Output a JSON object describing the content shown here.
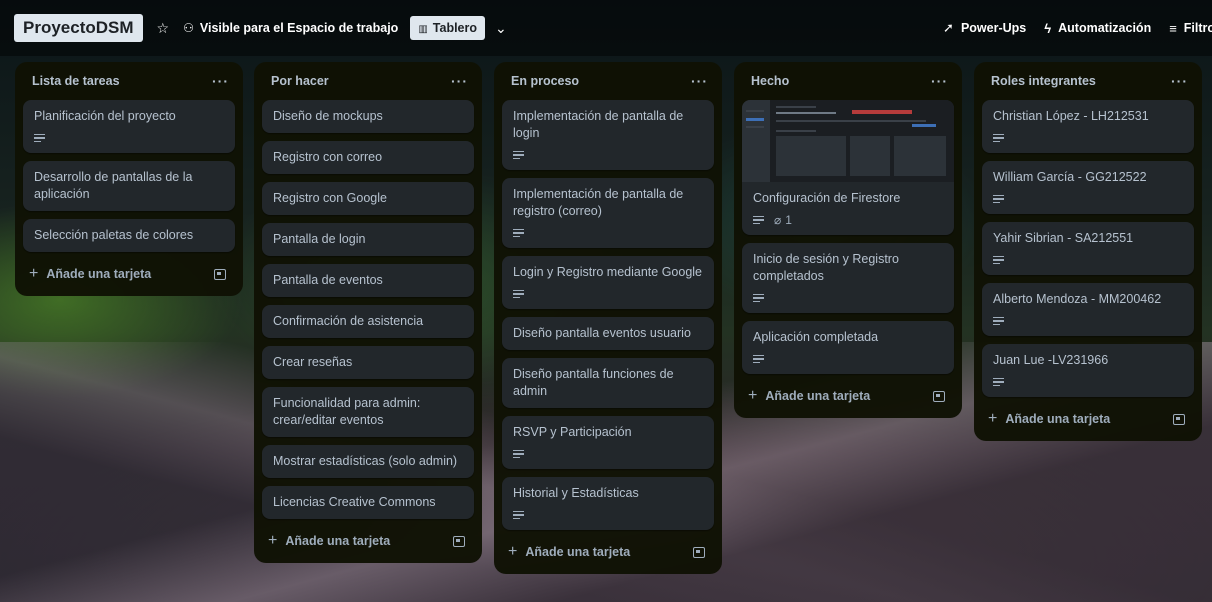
{
  "topbar": {
    "board_name": "ProyectoDSM",
    "visibility": "Visible para el Espacio de trabajo",
    "view_label": "Tablero",
    "power_ups": "Power-Ups",
    "automation": "Automatización",
    "filters": "Filtros"
  },
  "lists": [
    {
      "title": "Lista de tareas",
      "cards": [
        {
          "title": "Planificación del proyecto",
          "desc": true
        },
        {
          "title": "Desarrollo de pantallas de la aplicación",
          "desc": false
        },
        {
          "title": "Selección paletas de colores",
          "desc": false
        }
      ],
      "add_label": "Añade una tarjeta"
    },
    {
      "title": "Por hacer",
      "cards": [
        {
          "title": "Diseño de mockups"
        },
        {
          "title": "Registro con correo"
        },
        {
          "title": "Registro con Google"
        },
        {
          "title": "Pantalla de login"
        },
        {
          "title": "Pantalla de eventos"
        },
        {
          "title": "Confirmación de asistencia"
        },
        {
          "title": "Crear reseñas"
        },
        {
          "title": "Funcionalidad para admin: crear/editar eventos"
        },
        {
          "title": "Mostrar estadísticas (solo admin)"
        },
        {
          "title": "Licencias Creative Commons"
        }
      ],
      "add_label": "Añade una tarjeta"
    },
    {
      "title": "En proceso",
      "cards": [
        {
          "title": "Implementación de pantalla de login",
          "desc": true
        },
        {
          "title": "Implementación de pantalla de registro (correo)",
          "desc": true
        },
        {
          "title": "Login y Registro mediante Google",
          "desc": true
        },
        {
          "title": "Diseño pantalla eventos usuario"
        },
        {
          "title": "Diseño pantalla funciones de admin"
        },
        {
          "title": "RSVP y Participación",
          "desc": true
        },
        {
          "title": "Historial y Estadísticas",
          "desc": true
        }
      ],
      "add_label": "Añade una tarjeta"
    },
    {
      "title": "Hecho",
      "cards": [
        {
          "title": "Configuración de Firestore",
          "desc": true,
          "attachments": "1",
          "cover": true
        },
        {
          "title": "Inicio de sesión y Registro completados",
          "desc": true
        },
        {
          "title": "Aplicación completada",
          "desc": true
        }
      ],
      "add_label": "Añade una tarjeta"
    },
    {
      "title": "Roles integrantes",
      "cards": [
        {
          "title": "Christian López - LH212531",
          "desc": true
        },
        {
          "title": "William García - GG212522",
          "desc": true
        },
        {
          "title": "Yahir Sibrian - SA212551",
          "desc": true
        },
        {
          "title": "Alberto Mendoza - MM200462",
          "desc": true
        },
        {
          "title": "Juan Lue -LV231966",
          "desc": true
        }
      ],
      "add_label": "Añade una tarjeta"
    }
  ]
}
